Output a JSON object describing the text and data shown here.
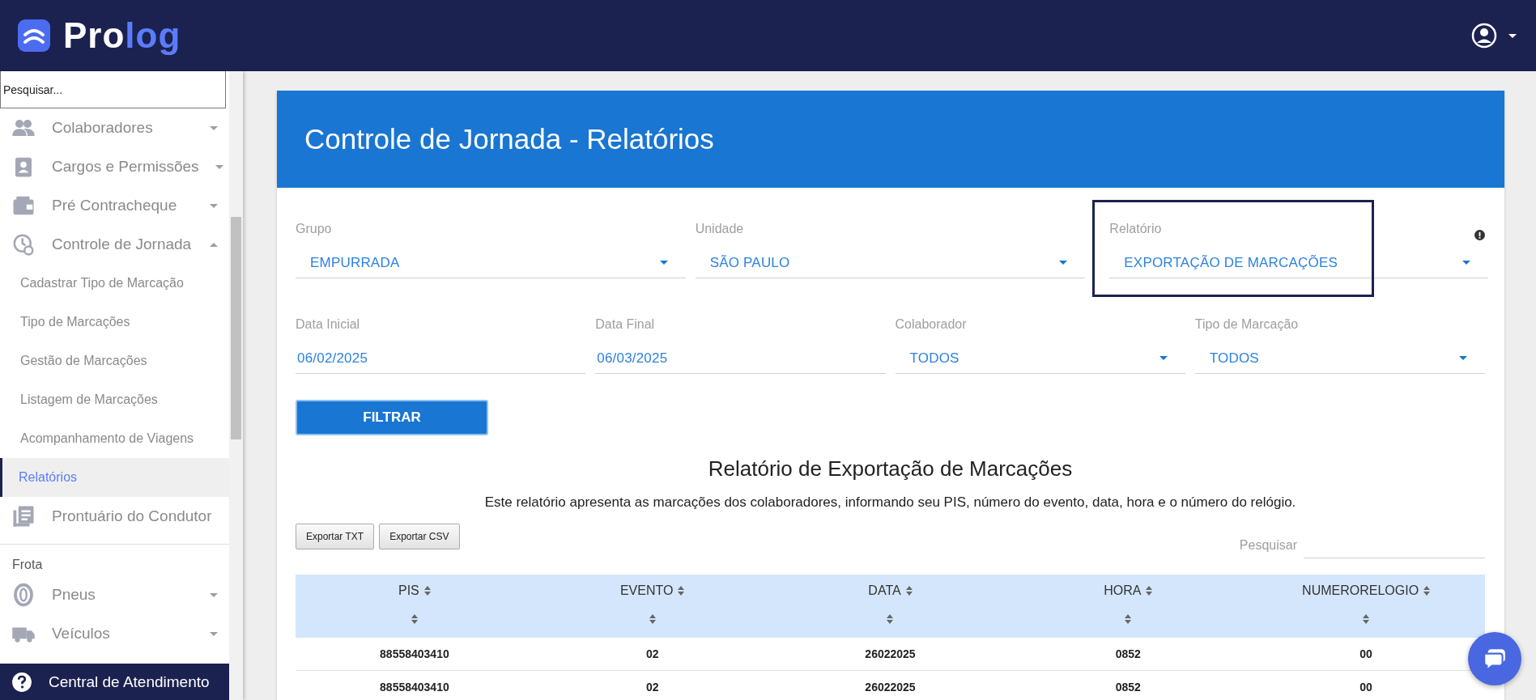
{
  "header": {
    "logo": {
      "part_a": "Pro",
      "part_b": "log"
    }
  },
  "sidebar": {
    "search": {
      "placeholder": "Pesquisar..."
    },
    "menu": [
      {
        "label": "Colaboradores",
        "expanded": false
      },
      {
        "label": "Cargos e Permissões",
        "expanded": false
      },
      {
        "label": "Pré Contracheque",
        "expanded": false
      },
      {
        "label": "Controle de Jornada",
        "expanded": true,
        "children": [
          {
            "label": "Cadastrar Tipo de Marcação",
            "selected": false
          },
          {
            "label": "Tipo de Marcações",
            "selected": false
          },
          {
            "label": "Gestão de Marcações",
            "selected": false
          },
          {
            "label": "Listagem de Marcações",
            "selected": false
          },
          {
            "label": "Acompanhamento de Viagens",
            "selected": false
          },
          {
            "label": "Relatórios",
            "selected": true
          }
        ]
      },
      {
        "label": "Prontuário do Condutor"
      }
    ],
    "section": "Frota",
    "fleet_menu": [
      {
        "label": "Pneus",
        "expanded": false
      },
      {
        "label": "Veículos",
        "expanded": false
      }
    ],
    "help": "Central de Atendimento"
  },
  "page": {
    "title": "Controle de Jornada - Relatórios",
    "filter_rows": [
      [
        {
          "kind": "select",
          "label": "Grupo",
          "value": "EMPURRADA",
          "focused": false
        },
        {
          "kind": "select",
          "label": "Unidade",
          "value": "SÃO PAULO",
          "focused": false
        },
        {
          "kind": "select",
          "label": "Relatório",
          "value": "EXPORTAÇÃO DE MARCAÇÕES",
          "focused": true
        }
      ],
      [
        {
          "kind": "date",
          "label": "Data Inicial",
          "value": "06/02/2025",
          "focused": false
        },
        {
          "kind": "date",
          "label": "Data Final",
          "value": "06/03/2025",
          "focused": false
        },
        {
          "kind": "select",
          "label": "Colaborador",
          "value": "TODOS",
          "focused": false
        },
        {
          "kind": "select",
          "label": "Tipo de Marcação",
          "value": "TODOS",
          "focused": false
        }
      ]
    ],
    "filter_button": "FILTRAR",
    "report": {
      "title": "Relatório de Exportação de Marcações",
      "description": "Este relatório apresenta as marcações dos colaboradores, informando seu PIS, número do evento, data, hora e o número do relógio.",
      "export_buttons": [
        "Exportar TXT",
        "Exportar CSV"
      ],
      "search": {
        "placeholder": "Pesquisar"
      },
      "table": {
        "columns": [
          "PIS",
          "EVENTO",
          "DATA",
          "HORA",
          "NUMERORELOGIO"
        ],
        "rows": [
          [
            "88558403410",
            "02",
            "26022025",
            "0852",
            "00"
          ],
          [
            "88558403410",
            "02",
            "26022025",
            "0852",
            "00"
          ]
        ]
      }
    }
  }
}
